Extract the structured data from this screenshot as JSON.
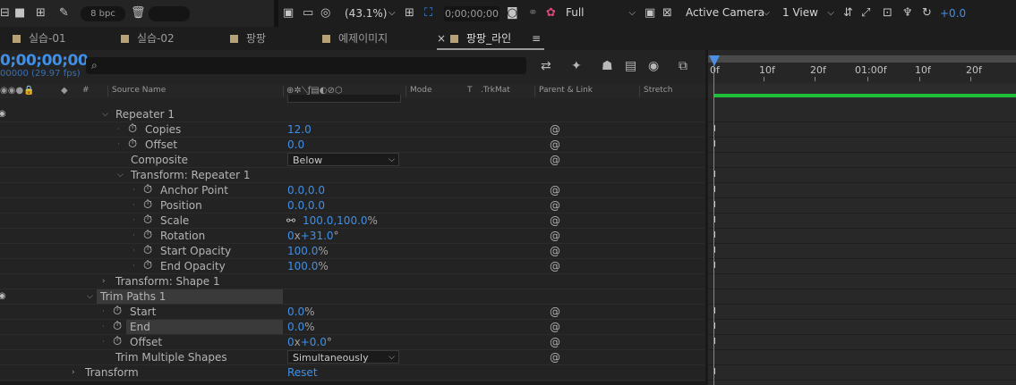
{
  "toolbar": {
    "bit_depth": "8 bpc",
    "zoom": "(43.1%)",
    "timecode": "0;00;00;00",
    "resolution": "Full",
    "camera": "Active Camera",
    "view_layout": "1 View",
    "exposure": "+0.0",
    "icons": [
      "flowchart-icon",
      "folder-icon",
      "composition-icon",
      "wrench-icon",
      "trash-icon",
      "monitor-icon",
      "mask-icon",
      "region-icon",
      "transparency-grid-icon",
      "camera-snapshot-icon",
      "show-snapshot-icon",
      "color-channel-icon",
      "toggle-transparency-icon",
      "3d-view-icon",
      "fast-preview-icon",
      "flowchart-icon",
      "reset-exposure-icon"
    ]
  },
  "tabs": [
    {
      "label": "실습-01",
      "color": "#b7a277"
    },
    {
      "label": "실습-02",
      "color": "#b7a277"
    },
    {
      "label": "팡팡",
      "color": "#b7a277"
    },
    {
      "label": "예제이미지",
      "color": "#b7a277"
    },
    {
      "label": "팡팡_라인",
      "color": "#b7a277",
      "active": true,
      "close": "×",
      "menu": "≡"
    }
  ],
  "timeline_header": {
    "timecode": "0;00;00;00",
    "fps": "00000 (29.97 fps)",
    "search_placeholder": "",
    "columns": {
      "hash": "#",
      "source_name": "Source Name",
      "mode": "Mode",
      "t": "T",
      "trkmat": ".TrkMat",
      "parent_link": "Parent & Link",
      "stretch": "Stretch"
    }
  },
  "layers": [
    {
      "label": "Repeater 1",
      "twirl": "v"
    },
    {
      "label": "Copies",
      "value": "12.0",
      "stopwatch": true
    },
    {
      "label": "Offset",
      "value": "0.0",
      "stopwatch": true
    },
    {
      "label": "Composite",
      "dropdown": "Below"
    },
    {
      "label": "Transform: Repeater 1",
      "twirl": "v"
    },
    {
      "label": "Anchor Point",
      "value": "0.0,0.0",
      "stopwatch": true
    },
    {
      "label": "Position",
      "value": "0.0,0.0",
      "stopwatch": true
    },
    {
      "label": "Scale",
      "value": "100.0,100.0",
      "unit": "%",
      "stopwatch": true,
      "link": true
    },
    {
      "label": "Rotation",
      "value_a": "0",
      "unit_a": "x",
      "value": "+31.0",
      "unit": "°",
      "stopwatch": true
    },
    {
      "label": "Start Opacity",
      "value": "100.0",
      "unit": "%",
      "stopwatch": true
    },
    {
      "label": "End Opacity",
      "value": "100.0",
      "unit": "%",
      "stopwatch": true
    },
    {
      "label": "Transform: Shape 1",
      "twirl": ">"
    },
    {
      "label": "Trim Paths 1",
      "twirl": "v",
      "highlight": true
    },
    {
      "label": "Start",
      "value": "0.0",
      "unit": "%",
      "stopwatch": true
    },
    {
      "label": "End",
      "value": "0.0",
      "unit": "%",
      "stopwatch": true,
      "highlight": true
    },
    {
      "label": "Offset",
      "value_a": "0",
      "unit_a": "x",
      "value": "+0.0",
      "unit": "°",
      "stopwatch": true
    },
    {
      "label": "Trim Multiple Shapes",
      "dropdown": "Simultaneously"
    },
    {
      "label": "Transform",
      "twirl": ">",
      "value": "Reset"
    }
  ],
  "ruler": {
    "labels": [
      "0f",
      "10f",
      "20f",
      "01:00f",
      "10f",
      "20f"
    ]
  },
  "colors": {
    "accent_blue": "#3f8fe8",
    "work_area_green": "#1fbf3a",
    "label_tan": "#b7a277"
  }
}
